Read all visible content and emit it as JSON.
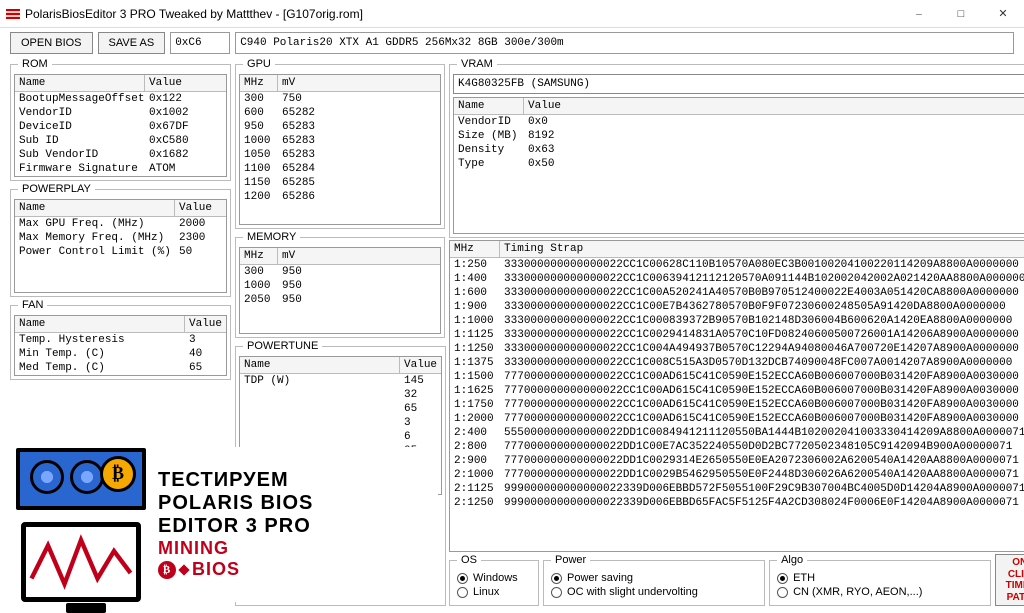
{
  "window": {
    "title": "PolarisBiosEditor 3 PRO Tweaked by Mattthev - [G107orig.rom]"
  },
  "toolbar": {
    "open": "OPEN BIOS",
    "save": "SAVE AS",
    "hex": "0xC6",
    "desc": "C940 Polaris20 XTX A1 GDDR5 256Mx32 8GB 300e/300m"
  },
  "groups": {
    "rom": "ROM",
    "powerplay": "POWERPLAY",
    "fan": "FAN",
    "gpu": "GPU",
    "memory": "MEMORY",
    "powertune": "POWERTUNE",
    "vram": "VRAM",
    "os": "OS",
    "power": "Power",
    "algo": "Algo"
  },
  "headers": {
    "name": "Name",
    "value": "Value",
    "mhz": "MHz",
    "mv": "mV",
    "timing": "Timing Strap"
  },
  "rom": [
    {
      "name": "BootupMessageOffset",
      "value": "0x122"
    },
    {
      "name": "VendorID",
      "value": "0x1002"
    },
    {
      "name": "DeviceID",
      "value": "0x67DF"
    },
    {
      "name": "Sub ID",
      "value": "0xC580"
    },
    {
      "name": "Sub VendorID",
      "value": "0x1682"
    },
    {
      "name": "Firmware Signature",
      "value": "ATOM"
    }
  ],
  "powerplay": [
    {
      "name": "Max GPU Freq. (MHz)",
      "value": "2000"
    },
    {
      "name": "Max Memory Freq. (MHz)",
      "value": "2300"
    },
    {
      "name": "Power Control Limit (%)",
      "value": "50"
    }
  ],
  "fan": [
    {
      "name": "Temp. Hysteresis",
      "value": "3"
    },
    {
      "name": "Min Temp. (C)",
      "value": "40"
    },
    {
      "name": "Med Temp. (C)",
      "value": "65"
    }
  ],
  "gpu": [
    {
      "mhz": "300",
      "mv": "750"
    },
    {
      "mhz": "600",
      "mv": "65282"
    },
    {
      "mhz": "950",
      "mv": "65283"
    },
    {
      "mhz": "1000",
      "mv": "65283"
    },
    {
      "mhz": "1050",
      "mv": "65283"
    },
    {
      "mhz": "1100",
      "mv": "65284"
    },
    {
      "mhz": "1150",
      "mv": "65285"
    },
    {
      "mhz": "1200",
      "mv": "65286"
    }
  ],
  "memory": [
    {
      "mhz": "300",
      "mv": "950"
    },
    {
      "mhz": "1000",
      "mv": "950"
    },
    {
      "mhz": "2050",
      "mv": "950"
    }
  ],
  "powertune": [
    {
      "name": "TDP (W)",
      "value": "145"
    },
    {
      "name": "",
      "value": "32"
    },
    {
      "name": "",
      "value": "65"
    },
    {
      "name": "",
      "value": "3"
    },
    {
      "name": "",
      "value": "6"
    },
    {
      "name": "",
      "value": "05"
    }
  ],
  "vram": {
    "select": "K4G80325FB (SAMSUNG)",
    "rows": [
      {
        "name": "VendorID",
        "value": "0x0"
      },
      {
        "name": "Size (MB)",
        "value": "8192"
      },
      {
        "name": "Density",
        "value": "0x63"
      },
      {
        "name": "Type",
        "value": "0x50"
      }
    ]
  },
  "timings": [
    {
      "mhz": "1:250",
      "strap": "333000000000000022CC1C00628C110B10570A080EC3B00100204100220114209A8800A0000000"
    },
    {
      "mhz": "1:400",
      "strap": "333000000000000022CC1C00639412112120570A091144B102002042002A021420AA8800A0000000"
    },
    {
      "mhz": "1:600",
      "strap": "333000000000000022CC1C00A520241A40570B0B970512400022E4003A051420CA8800A0000000"
    },
    {
      "mhz": "1:900",
      "strap": "333000000000000022CC1C00E7B4362780570B0F9F07230600248505A91420DA8800A0000000"
    },
    {
      "mhz": "1:1000",
      "strap": "333000000000000022CC1C000839372B90570B102148D306004B600620A1420EA8800A0000000"
    },
    {
      "mhz": "1:1125",
      "strap": "333000000000000022CC1C0029414831A0570C10FD08240600500726001A14206A8900A0000000"
    },
    {
      "mhz": "1:1250",
      "strap": "333000000000000022CC1C004A494937B0570C12294A94080046A700720E14207A8900A0000000"
    },
    {
      "mhz": "1:1375",
      "strap": "333000000000000022CC1C008C515A3D0570D132DCB74090048FC007A0014207A8900A0000000"
    },
    {
      "mhz": "1:1500",
      "strap": "777000000000000022CC1C00AD615C41C0590E152ECCA60B006007000B031420FA8900A0030000"
    },
    {
      "mhz": "1:1625",
      "strap": "777000000000000022CC1C00AD615C41C0590E152ECCA60B006007000B031420FA8900A0030000"
    },
    {
      "mhz": "1:1750",
      "strap": "777000000000000022CC1C00AD615C41C0590E152ECCA60B006007000B031420FA8900A0030000"
    },
    {
      "mhz": "1:2000",
      "strap": "777000000000000022CC1C00AD615C41C0590E152ECCA60B006007000B031420FA8900A0030000"
    },
    {
      "mhz": "2:400",
      "strap": "555000000000000022DD1C0084941211120550BA1444B102002041003330414209A8800A0000071"
    },
    {
      "mhz": "2:800",
      "strap": "777000000000000022DD1C00E7AC352240550D0D2BC7720502348105C9142094B900A00000071"
    },
    {
      "mhz": "2:900",
      "strap": "777000000000000022DD1C0029314E2650550E0EA2072306002A6200540A1420AA8800A0000071"
    },
    {
      "mhz": "2:1000",
      "strap": "777000000000000022DD1C0029B5462950550E0F2448D306026A6200540A1420AA8800A0000071"
    },
    {
      "mhz": "2:1125",
      "strap": "999000000000000022339D006EBBD572F5055100F29C9B307004BC4005D0D14204A8900A0000071"
    },
    {
      "mhz": "2:1250",
      "strap": "999000000000000022339D006EBBD65FAC5F5125F4A2CD308024F0006E0F14204A8900A0000071"
    }
  ],
  "os": {
    "opt1": "Windows",
    "opt2": "Linux",
    "selected": 0
  },
  "power": {
    "opt1": "Power saving",
    "opt2": "OC with slight undervolting",
    "selected": 0
  },
  "algo": {
    "opt1": "ETH",
    "opt2": "CN (XMR, RYO, AEON,...)",
    "selected": 0
  },
  "patch": "ONE\nCLICK\nTIMING\nPATCH",
  "overlay": {
    "l1": "ТЕСТИРУЕМ",
    "l2": "POLARIS BIOS",
    "l3": "EDITOR 3 PRO",
    "l4a": "MINING",
    "l4b": "BIOS"
  }
}
